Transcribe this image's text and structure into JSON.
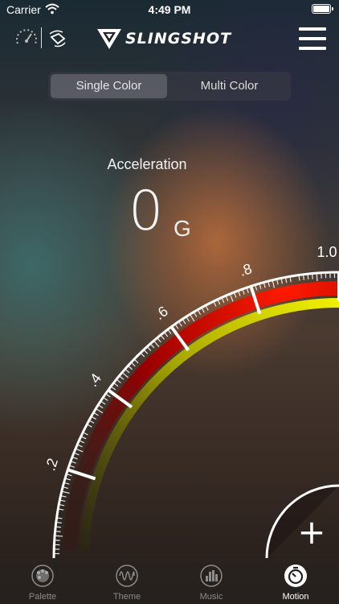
{
  "status": {
    "carrier": "Carrier",
    "time": "4:49 PM"
  },
  "header": {
    "brand": "SLINGSHOT"
  },
  "segment": {
    "single": "Single Color",
    "multi": "Multi Color",
    "selected": "Single Color"
  },
  "reading": {
    "label": "Acceleration",
    "value": "0",
    "unit": "G"
  },
  "gauge": {
    "ticks": [
      ".2",
      ".4",
      ".6",
      ".8",
      "1.0"
    ],
    "current_value": 0,
    "add_label": "+"
  },
  "tabs": [
    {
      "label": "Palette",
      "icon": "palette-icon",
      "active": false
    },
    {
      "label": "Theme",
      "icon": "waveform-icon",
      "active": false
    },
    {
      "label": "Music",
      "icon": "equalizer-icon",
      "active": false
    },
    {
      "label": "Motion",
      "icon": "motion-icon",
      "active": true
    }
  ],
  "colors": {
    "band_outer": "#e00000",
    "band_inner": "#d4d400",
    "accent": "#ffffff"
  }
}
